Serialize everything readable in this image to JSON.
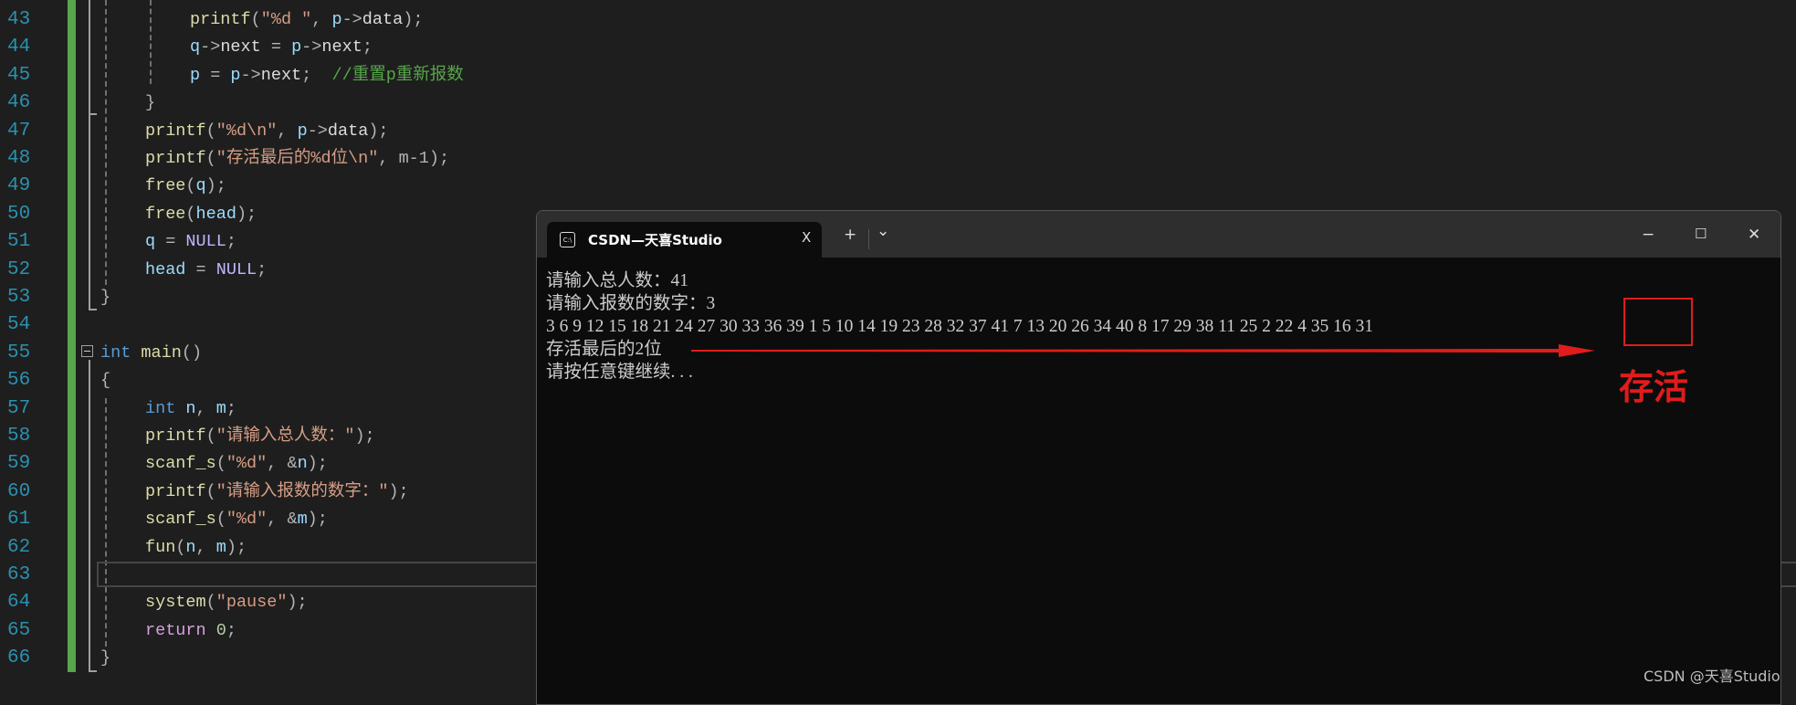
{
  "editor": {
    "lines": [
      {
        "num": "43",
        "indent": 2,
        "tokens": [
          {
            "t": "printf",
            "c": "fn"
          },
          {
            "t": "(",
            "c": "op"
          },
          {
            "t": "\"%d \"",
            "c": "str"
          },
          {
            "t": ", ",
            "c": "op"
          },
          {
            "t": "p",
            "c": "var"
          },
          {
            "t": "->",
            "c": "op"
          },
          {
            "t": "data",
            "c": "pl"
          },
          {
            "t": ");",
            "c": "op"
          }
        ]
      },
      {
        "num": "44",
        "indent": 2,
        "tokens": [
          {
            "t": "q",
            "c": "var"
          },
          {
            "t": "->",
            "c": "op"
          },
          {
            "t": "next",
            "c": "pl"
          },
          {
            "t": " = ",
            "c": "op"
          },
          {
            "t": "p",
            "c": "var"
          },
          {
            "t": "->",
            "c": "op"
          },
          {
            "t": "next",
            "c": "pl"
          },
          {
            "t": ";",
            "c": "op"
          }
        ]
      },
      {
        "num": "45",
        "indent": 2,
        "tokens": [
          {
            "t": "p",
            "c": "var"
          },
          {
            "t": " = ",
            "c": "op"
          },
          {
            "t": "p",
            "c": "var"
          },
          {
            "t": "->",
            "c": "op"
          },
          {
            "t": "next",
            "c": "pl"
          },
          {
            "t": ";  ",
            "c": "op"
          },
          {
            "t": "//重置p重新报数",
            "c": "cm"
          }
        ]
      },
      {
        "num": "46",
        "indent": 1,
        "tokens": [
          {
            "t": "}",
            "c": "op"
          }
        ]
      },
      {
        "num": "47",
        "indent": 1,
        "tokens": [
          {
            "t": "printf",
            "c": "fn"
          },
          {
            "t": "(",
            "c": "op"
          },
          {
            "t": "\"%d\\n\"",
            "c": "str"
          },
          {
            "t": ", ",
            "c": "op"
          },
          {
            "t": "p",
            "c": "var"
          },
          {
            "t": "->",
            "c": "op"
          },
          {
            "t": "data",
            "c": "pl"
          },
          {
            "t": ");",
            "c": "op"
          }
        ]
      },
      {
        "num": "48",
        "indent": 1,
        "tokens": [
          {
            "t": "printf",
            "c": "fn"
          },
          {
            "t": "(",
            "c": "op"
          },
          {
            "t": "\"存活最后的%d位\\n\"",
            "c": "str"
          },
          {
            "t": ", ",
            "c": "op"
          },
          {
            "t": "m-1",
            "c": "op"
          },
          {
            "t": ");",
            "c": "op"
          }
        ]
      },
      {
        "num": "49",
        "indent": 1,
        "tokens": [
          {
            "t": "free",
            "c": "fn"
          },
          {
            "t": "(",
            "c": "op"
          },
          {
            "t": "q",
            "c": "var"
          },
          {
            "t": ");",
            "c": "op"
          }
        ]
      },
      {
        "num": "50",
        "indent": 1,
        "tokens": [
          {
            "t": "free",
            "c": "fn"
          },
          {
            "t": "(",
            "c": "op"
          },
          {
            "t": "head",
            "c": "var"
          },
          {
            "t": ");",
            "c": "op"
          }
        ]
      },
      {
        "num": "51",
        "indent": 1,
        "tokens": [
          {
            "t": "q",
            "c": "var"
          },
          {
            "t": " = ",
            "c": "op"
          },
          {
            "t": "NULL",
            "c": "mac"
          },
          {
            "t": ";",
            "c": "op"
          }
        ]
      },
      {
        "num": "52",
        "indent": 1,
        "tokens": [
          {
            "t": "head",
            "c": "var"
          },
          {
            "t": " = ",
            "c": "op"
          },
          {
            "t": "NULL",
            "c": "mac"
          },
          {
            "t": ";",
            "c": "op"
          }
        ]
      },
      {
        "num": "53",
        "indent": 0,
        "tokens": [
          {
            "t": "}",
            "c": "op"
          }
        ]
      },
      {
        "num": "54",
        "indent": 0,
        "tokens": []
      },
      {
        "num": "55",
        "indent": 0,
        "tokens": [
          {
            "t": "int",
            "c": "kw"
          },
          {
            "t": " ",
            "c": "op"
          },
          {
            "t": "main",
            "c": "fn"
          },
          {
            "t": "()",
            "c": "op"
          }
        ]
      },
      {
        "num": "56",
        "indent": 0,
        "tokens": [
          {
            "t": "{",
            "c": "op"
          }
        ]
      },
      {
        "num": "57",
        "indent": 1,
        "tokens": [
          {
            "t": "int",
            "c": "kw"
          },
          {
            "t": " ",
            "c": "op"
          },
          {
            "t": "n",
            "c": "var"
          },
          {
            "t": ", ",
            "c": "op"
          },
          {
            "t": "m",
            "c": "var"
          },
          {
            "t": ";",
            "c": "op"
          }
        ]
      },
      {
        "num": "58",
        "indent": 1,
        "tokens": [
          {
            "t": "printf",
            "c": "fn"
          },
          {
            "t": "(",
            "c": "op"
          },
          {
            "t": "\"请输入总人数：\"",
            "c": "str"
          },
          {
            "t": ");",
            "c": "op"
          }
        ]
      },
      {
        "num": "59",
        "indent": 1,
        "tokens": [
          {
            "t": "scanf_s",
            "c": "fn"
          },
          {
            "t": "(",
            "c": "op"
          },
          {
            "t": "\"%d\"",
            "c": "str"
          },
          {
            "t": ", &",
            "c": "op"
          },
          {
            "t": "n",
            "c": "var"
          },
          {
            "t": ");",
            "c": "op"
          }
        ]
      },
      {
        "num": "60",
        "indent": 1,
        "tokens": [
          {
            "t": "printf",
            "c": "fn"
          },
          {
            "t": "(",
            "c": "op"
          },
          {
            "t": "\"请输入报数的数字：\"",
            "c": "str"
          },
          {
            "t": ");",
            "c": "op"
          }
        ]
      },
      {
        "num": "61",
        "indent": 1,
        "tokens": [
          {
            "t": "scanf_s",
            "c": "fn"
          },
          {
            "t": "(",
            "c": "op"
          },
          {
            "t": "\"%d\"",
            "c": "str"
          },
          {
            "t": ", &",
            "c": "op"
          },
          {
            "t": "m",
            "c": "var"
          },
          {
            "t": ");",
            "c": "op"
          }
        ]
      },
      {
        "num": "62",
        "indent": 1,
        "tokens": [
          {
            "t": "fun",
            "c": "fn"
          },
          {
            "t": "(",
            "c": "op"
          },
          {
            "t": "n",
            "c": "var"
          },
          {
            "t": ", ",
            "c": "op"
          },
          {
            "t": "m",
            "c": "var"
          },
          {
            "t": ");",
            "c": "op"
          }
        ]
      },
      {
        "num": "63",
        "indent": 1,
        "tokens": []
      },
      {
        "num": "64",
        "indent": 1,
        "tokens": [
          {
            "t": "system",
            "c": "fn"
          },
          {
            "t": "(",
            "c": "op"
          },
          {
            "t": "\"pause\"",
            "c": "str"
          },
          {
            "t": ");",
            "c": "op"
          }
        ]
      },
      {
        "num": "65",
        "indent": 1,
        "tokens": [
          {
            "t": "return",
            "c": "ctl"
          },
          {
            "t": " ",
            "c": "op"
          },
          {
            "t": "0",
            "c": "num"
          },
          {
            "t": ";",
            "c": "op"
          }
        ]
      },
      {
        "num": "66",
        "indent": 0,
        "tokens": [
          {
            "t": "}",
            "c": "op"
          }
        ]
      }
    ]
  },
  "terminal": {
    "tab_title": "CSDN—天喜Studio",
    "tab_icon": "console-icon",
    "close_tab": "X",
    "new_tab": "+",
    "dropdown": "⌄",
    "minimize": "−",
    "maximize": "☐",
    "close": "✕",
    "output": [
      "请输入总人数：41",
      "请输入报数的数字：3",
      "3 6 9 12 15 18 21 24 27 30 33 36 39 1 5 10 14 19 23 28 32 37 41 7 13 20 26 34 40 8 17 29 38 11 25 2 22 4 35 16 31",
      "存活最后的2位",
      "请按任意键继续. . ."
    ]
  },
  "annotation": {
    "label": "存活",
    "color": "#e01c1c"
  },
  "watermark": "CSDN @天喜Studio"
}
